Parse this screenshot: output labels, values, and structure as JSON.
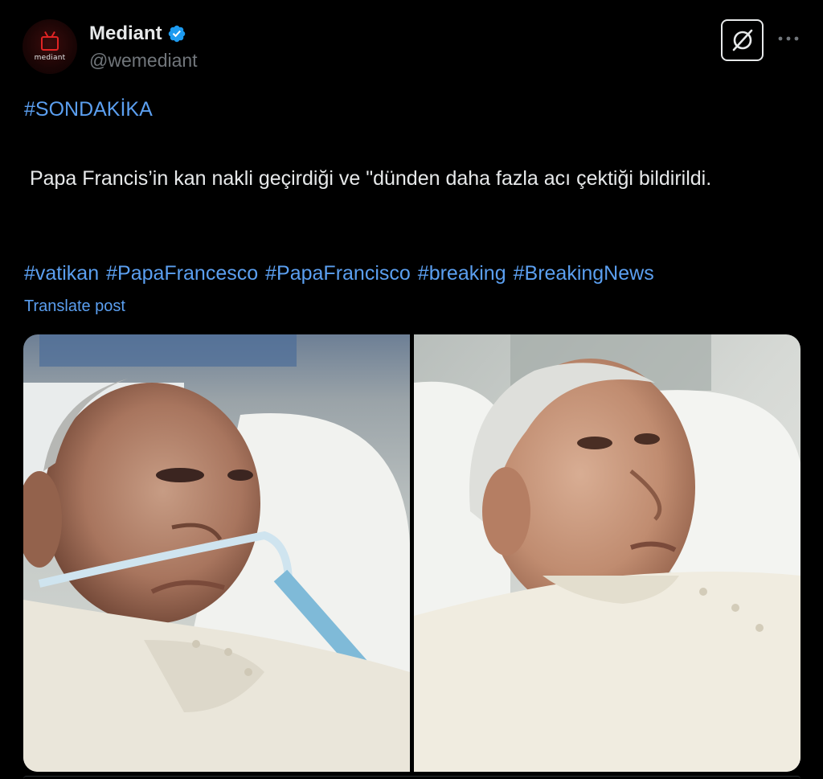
{
  "author": {
    "display_name": "Mediant",
    "handle": "@wemediant",
    "avatar_text": "mediant",
    "verified": true,
    "verified_color": "#1d9bf0"
  },
  "post": {
    "hashtag_top": "#SONDAKİKA",
    "text": " Papa Francis’in kan nakli geçirdiği ve \"dünden daha fazla acı çektiği bildirildi.",
    "hashtags": [
      "#vatikan",
      "#PapaFrancesco",
      "#PapaFrancisco",
      "#breaking",
      "#BreakingNews"
    ],
    "translate_label": "Translate post"
  },
  "icons": {
    "verified": "verified-badge-icon",
    "grok": "grok-icon",
    "more": "more-options-icon"
  },
  "colors": {
    "background": "#000000",
    "text": "#e7e9ea",
    "muted": "#71767b",
    "link": "#5b9ff0"
  },
  "media": {
    "count": 2
  }
}
